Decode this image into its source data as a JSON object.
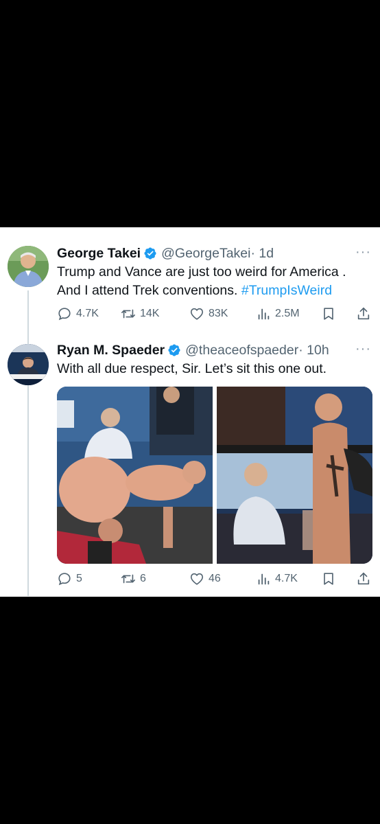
{
  "tweets": [
    {
      "name": "George Takei",
      "handle": "@GeorgeTakei",
      "time": "· 1d",
      "line1": "Trump and Vance are just too weird for America .",
      "line2_text": "And I attend Trek conventions.",
      "hashtag": "#TrumpIsWeird",
      "more": "···",
      "stats": {
        "replies": "4.7K",
        "reposts": "14K",
        "likes": "83K",
        "views": "2.5M"
      }
    },
    {
      "name": "Ryan M. Spaeder",
      "handle": "@theaceofspaeder",
      "time": "· 10h",
      "text": "With all due respect, Sir. Let’s sit this one out.",
      "more": "···",
      "stats": {
        "replies": "5",
        "reposts": "6",
        "likes": "46",
        "views": "4.7K"
      }
    }
  ],
  "colors": {
    "verified": "#1d9bf0",
    "hashtag": "#1d9bf0",
    "meta": "#536471"
  },
  "icons": [
    "verified-badge-icon",
    "reply-icon",
    "repost-icon",
    "like-icon",
    "views-icon",
    "bookmark-icon",
    "share-icon",
    "more-icon"
  ]
}
